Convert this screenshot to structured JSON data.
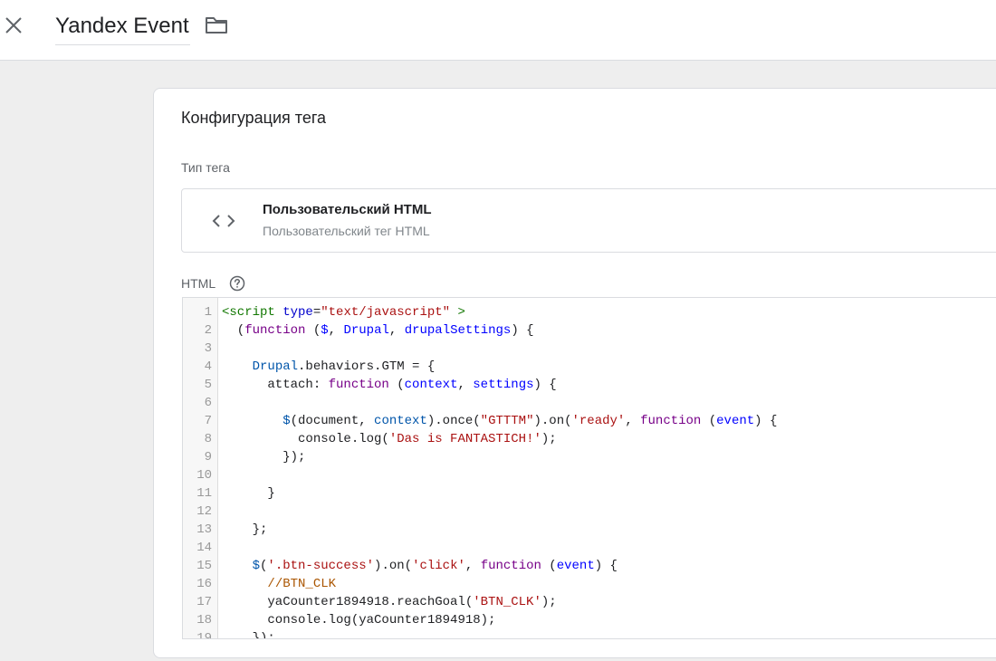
{
  "header": {
    "title": "Yandex Event",
    "close_icon": "close-icon",
    "folder_icon": "folder-icon"
  },
  "card": {
    "title": "Конфигурация тега",
    "tag_type_label": "Тип тега",
    "tag_type": {
      "icon": "code-brackets-icon",
      "name": "Пользовательский HTML",
      "description": "Пользовательский тег HTML"
    },
    "html_label": "HTML",
    "help_icon": "help-circle-icon"
  },
  "editor": {
    "lines": [
      {
        "n": "1",
        "tokens": [
          [
            "tag",
            "<script "
          ],
          [
            "attr",
            "type"
          ],
          [
            "",
            "="
          ],
          [
            "str",
            "\"text/javascript\""
          ],
          [
            "tag",
            " >"
          ]
        ]
      },
      {
        "n": "2",
        "tokens": [
          [
            "",
            "  ("
          ],
          [
            "kw",
            "function"
          ],
          [
            "",
            " ("
          ],
          [
            "def",
            "$"
          ],
          [
            "",
            ", "
          ],
          [
            "def",
            "Drupal"
          ],
          [
            "",
            ", "
          ],
          [
            "def",
            "drupalSettings"
          ],
          [
            "",
            ") {"
          ]
        ]
      },
      {
        "n": "3",
        "tokens": []
      },
      {
        "n": "4",
        "tokens": [
          [
            "",
            "    "
          ],
          [
            "var2",
            "Drupal"
          ],
          [
            "",
            ".behaviors.GTM = {"
          ]
        ]
      },
      {
        "n": "5",
        "tokens": [
          [
            "",
            "      attach: "
          ],
          [
            "kw",
            "function"
          ],
          [
            "",
            " ("
          ],
          [
            "def",
            "context"
          ],
          [
            "",
            ", "
          ],
          [
            "def",
            "settings"
          ],
          [
            "",
            ") {"
          ]
        ]
      },
      {
        "n": "6",
        "tokens": []
      },
      {
        "n": "7",
        "tokens": [
          [
            "",
            "        "
          ],
          [
            "var2",
            "$"
          ],
          [
            "",
            "(document, "
          ],
          [
            "var2",
            "context"
          ],
          [
            "",
            ").once("
          ],
          [
            "str",
            "\"GTTTM\""
          ],
          [
            "",
            ").on("
          ],
          [
            "str",
            "'ready'"
          ],
          [
            "",
            ", "
          ],
          [
            "kw",
            "function"
          ],
          [
            "",
            " ("
          ],
          [
            "def",
            "event"
          ],
          [
            "",
            ") {"
          ]
        ]
      },
      {
        "n": "8",
        "tokens": [
          [
            "",
            "          console.log("
          ],
          [
            "str",
            "'Das is FANTASTICH!'"
          ],
          [
            "",
            ");"
          ]
        ]
      },
      {
        "n": "9",
        "tokens": [
          [
            "",
            "        });"
          ]
        ]
      },
      {
        "n": "10",
        "tokens": []
      },
      {
        "n": "11",
        "tokens": [
          [
            "",
            "      }"
          ]
        ]
      },
      {
        "n": "12",
        "tokens": []
      },
      {
        "n": "13",
        "tokens": [
          [
            "",
            "    };"
          ]
        ]
      },
      {
        "n": "14",
        "tokens": []
      },
      {
        "n": "15",
        "tokens": [
          [
            "",
            "    "
          ],
          [
            "var2",
            "$"
          ],
          [
            "",
            "("
          ],
          [
            "str",
            "'.btn-success'"
          ],
          [
            "",
            ").on("
          ],
          [
            "str",
            "'click'"
          ],
          [
            "",
            ", "
          ],
          [
            "kw",
            "function"
          ],
          [
            "",
            " ("
          ],
          [
            "def",
            "event"
          ],
          [
            "",
            ") {"
          ]
        ]
      },
      {
        "n": "16",
        "tokens": [
          [
            "",
            "      "
          ],
          [
            "com",
            "//BTN_CLK"
          ]
        ]
      },
      {
        "n": "17",
        "tokens": [
          [
            "",
            "      yaCounter1894918.reachGoal("
          ],
          [
            "str",
            "'BTN_CLK'"
          ],
          [
            "",
            ");"
          ]
        ]
      },
      {
        "n": "18",
        "tokens": [
          [
            "",
            "      console.log(yaCounter1894918);"
          ]
        ]
      },
      {
        "n": "19",
        "tokens": [
          [
            "",
            "    });"
          ]
        ]
      }
    ]
  }
}
